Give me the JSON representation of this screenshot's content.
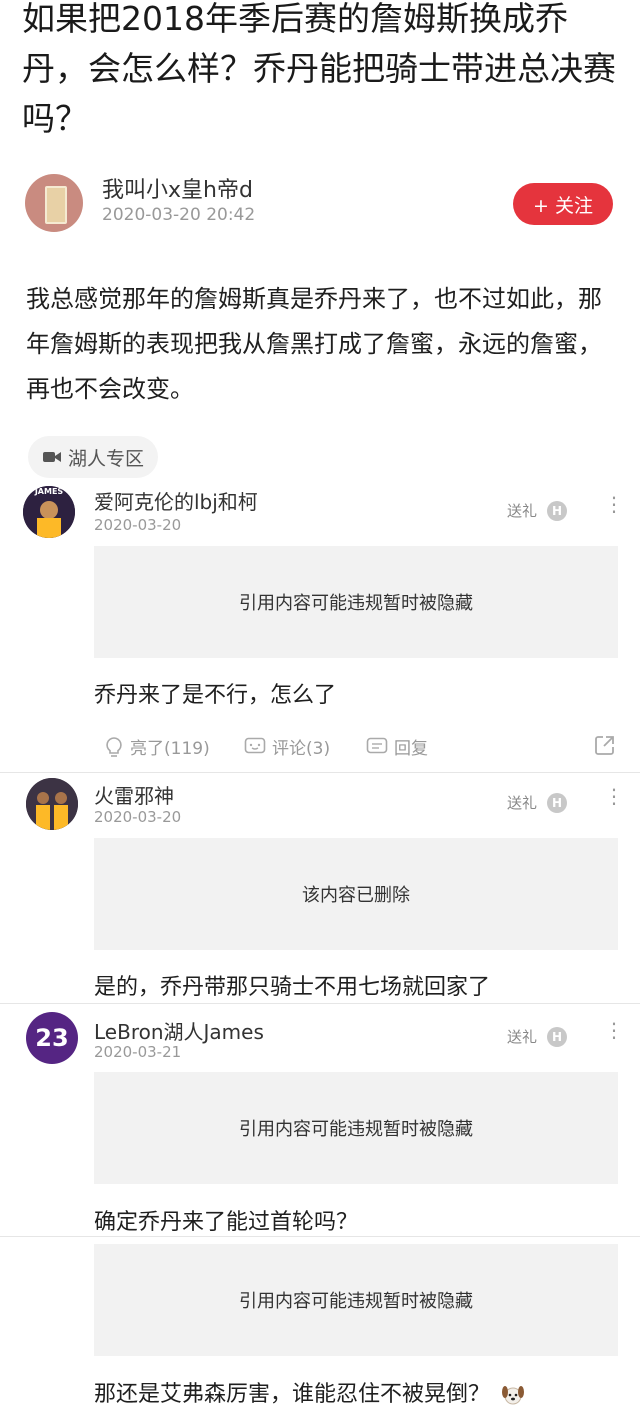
{
  "post": {
    "title": "如果把2018年季后赛的詹姆斯换成乔丹，会怎么样？乔丹能把骑士带进总决赛吗？",
    "author": {
      "name": "我叫小x皇h帝d",
      "time": "2020-03-20 20:42"
    },
    "follow_label": "+ 关注",
    "body": "我总感觉那年的詹姆斯真是乔丹来了，也不过如此，那年詹姆斯的表现把我从詹黑打成了詹蜜，永远的詹蜜，再也不会改变。",
    "tag": {
      "icon": "video-icon",
      "label": "湖人专区"
    }
  },
  "gift_label": "送礼",
  "badge_letter": "H",
  "comments": [
    {
      "name": "爱阿克伦的lbj和柯",
      "avatar_text": "JAMES",
      "time": "2020-03-20",
      "quote": "引用内容可能违规暂时被隐藏",
      "text": "乔丹来了是不行，怎么了",
      "actions": {
        "like": "亮了(119)",
        "comment": "评论(3)",
        "reply": "回复"
      }
    },
    {
      "name": "火雷邪神",
      "time": "2020-03-20",
      "quote": "该内容已删除",
      "text": "是的，乔丹带那只骑士不用七场就回家了"
    },
    {
      "name": "LeBron湖人James",
      "avatar_text": "23",
      "time": "2020-03-21",
      "quote": "引用内容可能违规暂时被隐藏",
      "text": "确定乔丹来了能过首轮吗？"
    },
    {
      "quote": "引用内容可能违规暂时被隐藏",
      "text": "那还是艾弗森厉害，谁能忍住不被晃倒？"
    }
  ],
  "colors": {
    "follow": "#e5343d",
    "lakers_purple": "#552583",
    "lakers_gold": "#fdb927",
    "quote_bg": "#f2f2f2"
  }
}
